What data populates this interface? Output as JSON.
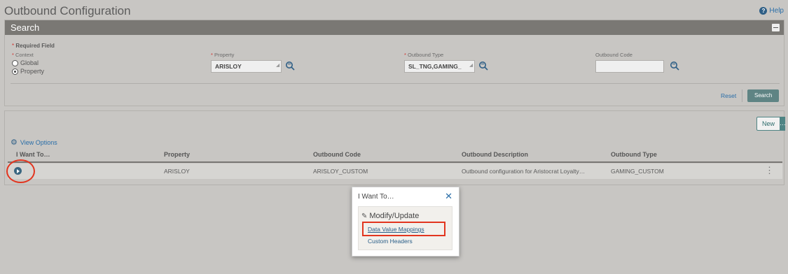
{
  "page": {
    "title": "Outbound Configuration",
    "help_label": "Help"
  },
  "search": {
    "header": "Search",
    "required_note": "Required Field",
    "context": {
      "label": "Context",
      "options": [
        "Global",
        "Property"
      ],
      "selected": "Property"
    },
    "property": {
      "label": "Property",
      "value": "ARISLOY"
    },
    "outbound_type": {
      "label": "Outbound Type",
      "value": "SL_TNG,GAMING_"
    },
    "outbound_code": {
      "label": "Outbound Code",
      "value": ""
    },
    "reset_label": "Reset",
    "search_label": "Search"
  },
  "results": {
    "new_label": "New",
    "more_label": "…",
    "view_options_label": "View Options",
    "columns": [
      "I Want To…",
      "Property",
      "Outbound Code",
      "Outbound Description",
      "Outbound Type"
    ],
    "rows": [
      {
        "property": "ARISLOY",
        "outbound_code": "ARISLOY_CUSTOM",
        "outbound_description": "Outbound configuration for Aristocrat Loyalty…",
        "outbound_type": "GAMING_CUSTOM"
      }
    ]
  },
  "popup": {
    "title": "I Want To…",
    "close_label": "✕",
    "section": "Modify/Update",
    "links": [
      "Data Value Mappings",
      "Custom Headers"
    ]
  },
  "colors": {
    "accent": "#5f8484",
    "link": "#2a6ea8",
    "highlight": "#e2351f",
    "header_bar": "#7a7874"
  }
}
